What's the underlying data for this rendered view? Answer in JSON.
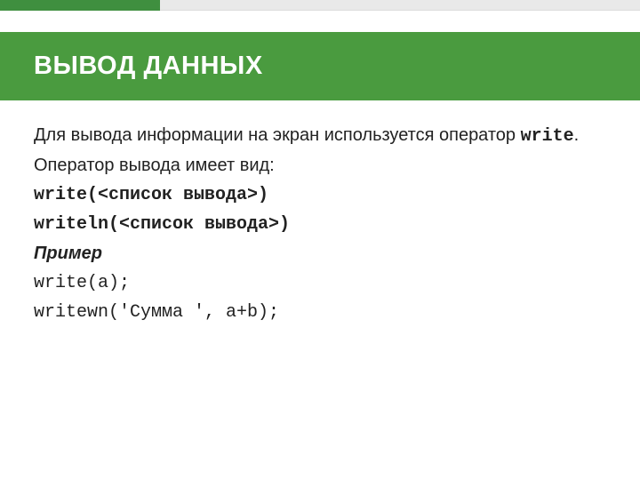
{
  "header": {
    "title": "ВЫВОД ДАННЫХ"
  },
  "body": {
    "intro_part1": "Для вывода информации на экран используется оператор ",
    "intro_code": "write",
    "intro_part2": ".",
    "line2": "Оператор вывода имеет вид:",
    "syntax1": "write(<список вывода>)",
    "syntax2": "writeln(<список вывода>)",
    "example_label": "Пример",
    "example1": "write(a);",
    "example2": "writewn('Сумма ', a+b);"
  }
}
